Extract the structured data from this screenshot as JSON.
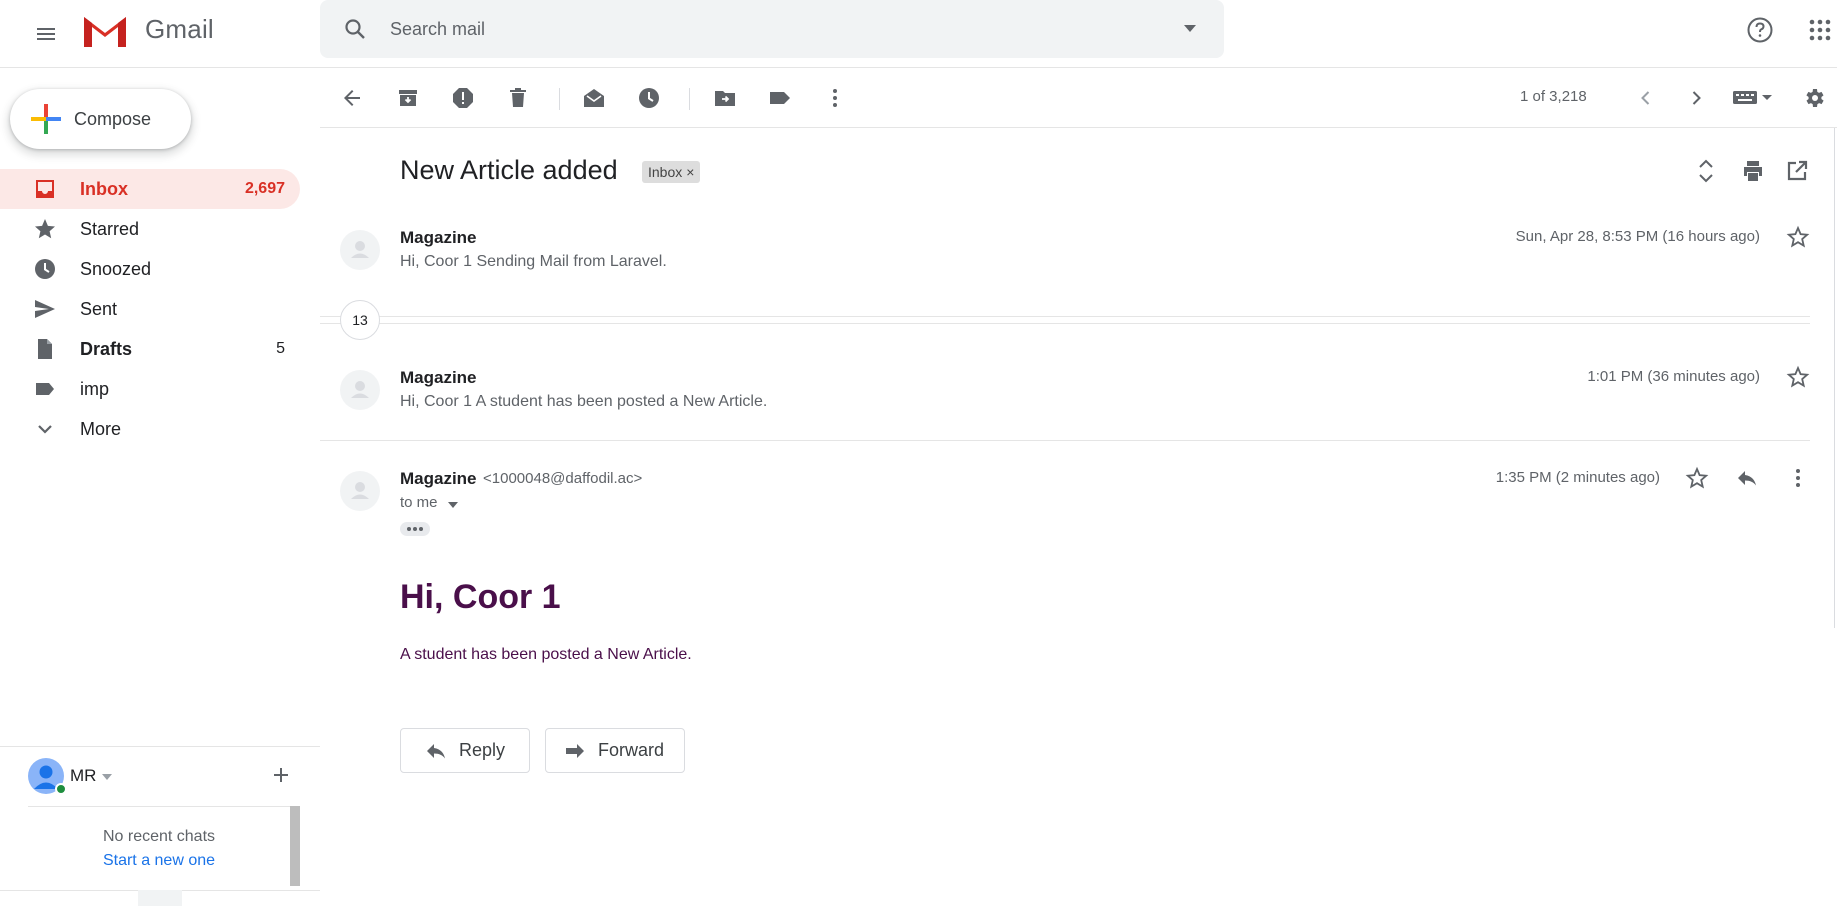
{
  "header": {
    "brand": "Gmail",
    "search_placeholder": "Search mail"
  },
  "sidebar": {
    "compose_label": "Compose",
    "items": [
      {
        "label": "Inbox",
        "count": "2,697",
        "icon": "inbox-icon",
        "active": true
      },
      {
        "label": "Starred",
        "count": "",
        "icon": "star-icon"
      },
      {
        "label": "Snoozed",
        "count": "",
        "icon": "clock-icon"
      },
      {
        "label": "Sent",
        "count": "",
        "icon": "send-icon"
      },
      {
        "label": "Drafts",
        "count": "5",
        "icon": "draft-icon"
      },
      {
        "label": "imp",
        "count": "",
        "icon": "label-icon"
      },
      {
        "label": "More",
        "count": "",
        "icon": "chevron-down-icon"
      }
    ]
  },
  "chat": {
    "user": "MR",
    "no_chats": "No recent chats",
    "start_link": "Start a new one"
  },
  "toolbar": {
    "pager": "1 of 3,218"
  },
  "thread": {
    "subject": "New Article added",
    "label_chip": "Inbox",
    "collapsed_count": "13",
    "messages": [
      {
        "sender": "Magazine",
        "snippet": "Hi, Coor 1 Sending Mail from Laravel.",
        "date": "Sun, Apr 28, 8:53 PM (16 hours ago)"
      },
      {
        "sender": "Magazine",
        "snippet": "Hi, Coor 1 A student has been posted a New Article.",
        "date": "1:01 PM (36 minutes ago)"
      }
    ],
    "expanded": {
      "sender": "Magazine",
      "email": "<1000048@daffodil.ac>",
      "to": "to me",
      "date": "1:35 PM (2 minutes ago)",
      "heading": "Hi, Coor 1",
      "body": "A student has been posted a New Article.",
      "reply_label": "Reply",
      "forward_label": "Forward"
    }
  },
  "colors": {
    "accent_red": "#d93025",
    "active_bg": "#fce8e6",
    "body_purple": "#4a0f4a",
    "link_blue": "#1a73e8"
  }
}
